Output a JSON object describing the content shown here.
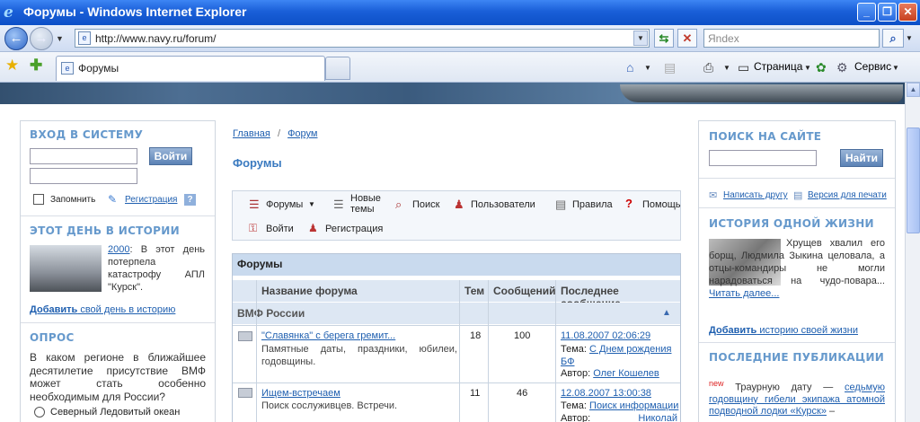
{
  "window": {
    "title": "Форумы - Windows Internet Explorer"
  },
  "nav": {
    "url": "http://www.navy.ru/forum/",
    "search_placeholder": "Яndex"
  },
  "tabs": [
    {
      "label": "Форумы"
    }
  ],
  "command_bar": {
    "page_label": "Страница",
    "tools_label": "Сервис"
  },
  "login": {
    "title": "ВХОД В СИСТЕМУ",
    "button": "Войти",
    "remember": "Запомнить",
    "register": "Регистрация",
    "help": "?"
  },
  "history_day": {
    "title": "ЭТОТ ДЕНЬ В ИСТОРИИ",
    "year": "2000",
    "text": ": В этот день потерпела катастрофу АПЛ \"Курск\".",
    "add_link": "Добавить",
    "add_rest": " свой день в историю"
  },
  "poll": {
    "title": "ОПРОС",
    "question": "В каком регионе в ближайшее десятилетие присутствие ВМФ может стать особенно необходимым для России?",
    "option1": "Северный Ледовитый океан"
  },
  "breadcrumb": {
    "home": "Главная",
    "sep": "/",
    "forum": "Форум"
  },
  "page_title": "Форумы",
  "forum_toolbar": {
    "forums": "Форумы",
    "new_topics": "Новые темы",
    "search": "Поиск",
    "users": "Пользователи",
    "rules": "Правила",
    "help": "Помощь",
    "login": "Войти",
    "register": "Регистрация"
  },
  "forum_table": {
    "caption": "Форумы",
    "headers": {
      "name": "Название форума",
      "topics": "Тем",
      "posts": "Сообщений",
      "last": "Последнее сообщение"
    },
    "section": "ВМФ России",
    "rows": [
      {
        "title": "\"Славянка\" с берега гремит...",
        "desc": "Памятные даты, праздники, юбилеи, годовщины.",
        "topics": "18",
        "posts": "100",
        "last_date": "11.08.2007 02:06:29",
        "topic_label": "Тема:",
        "topic": "С Днем рождения БФ",
        "author_label": "Автор:",
        "author": "Олег Кошелев"
      },
      {
        "title": "Ищем-встречаем",
        "desc": "Поиск сослуживцев. Встречи.",
        "topics": "11",
        "posts": "46",
        "last_date": "12.08.2007 13:00:38",
        "topic_label": "Тема:",
        "topic": "Поиск информации",
        "author_label": "Автор:",
        "author": "Николай"
      }
    ]
  },
  "site_search": {
    "title": "ПОИСК НА САЙТЕ",
    "button": "Найти",
    "write_friend": "Написать другу",
    "print_version": "Версия для печати"
  },
  "life_story": {
    "title": "ИСТОРИЯ ОДНОЙ ЖИЗНИ",
    "text": "Хрущев хвалил его борщ, Людмила Зыкина целовала, а отцы-командиры не могли нарадоваться на чудо-повара...",
    "read_more": "Читать далее...",
    "add_link": "Добавить",
    "add_rest": " историю своей жизни"
  },
  "publications": {
    "title": "ПОСЛЕДНИЕ ПУБЛИКАЦИИ",
    "new_badge": "new",
    "text": "Траурную дату —",
    "link": "седьмую годовщину гибели экипажа атомной подводной лодки «Курск»",
    "tail": "–"
  }
}
